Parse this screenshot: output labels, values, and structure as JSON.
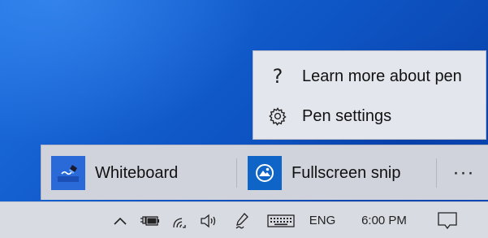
{
  "pen_menu": {
    "items": [
      {
        "label": "Learn more about pen",
        "icon": "help-question-icon"
      },
      {
        "label": "Pen settings",
        "icon": "gear-icon"
      }
    ]
  },
  "pen_workspace": {
    "apps": [
      {
        "label": "Whiteboard",
        "icon": "whiteboard-icon"
      },
      {
        "label": "Fullscreen snip",
        "icon": "snip-icon"
      }
    ],
    "more_label": "···"
  },
  "taskbar": {
    "language": "ENG",
    "time": "6:00 PM",
    "tray_icons": [
      "chevron-up-icon",
      "battery-plug-icon",
      "wifi-icon",
      "volume-icon",
      "pen-icon",
      "keyboard-icon",
      "notification-icon"
    ]
  },
  "colors": {
    "desktop": "#0f57c7",
    "menu_bg": "#e4e6ee",
    "bar_bg": "#d0d2dc",
    "taskbar_bg": "#d9dbe3",
    "app_icon_blue": "#2a6ad8"
  }
}
